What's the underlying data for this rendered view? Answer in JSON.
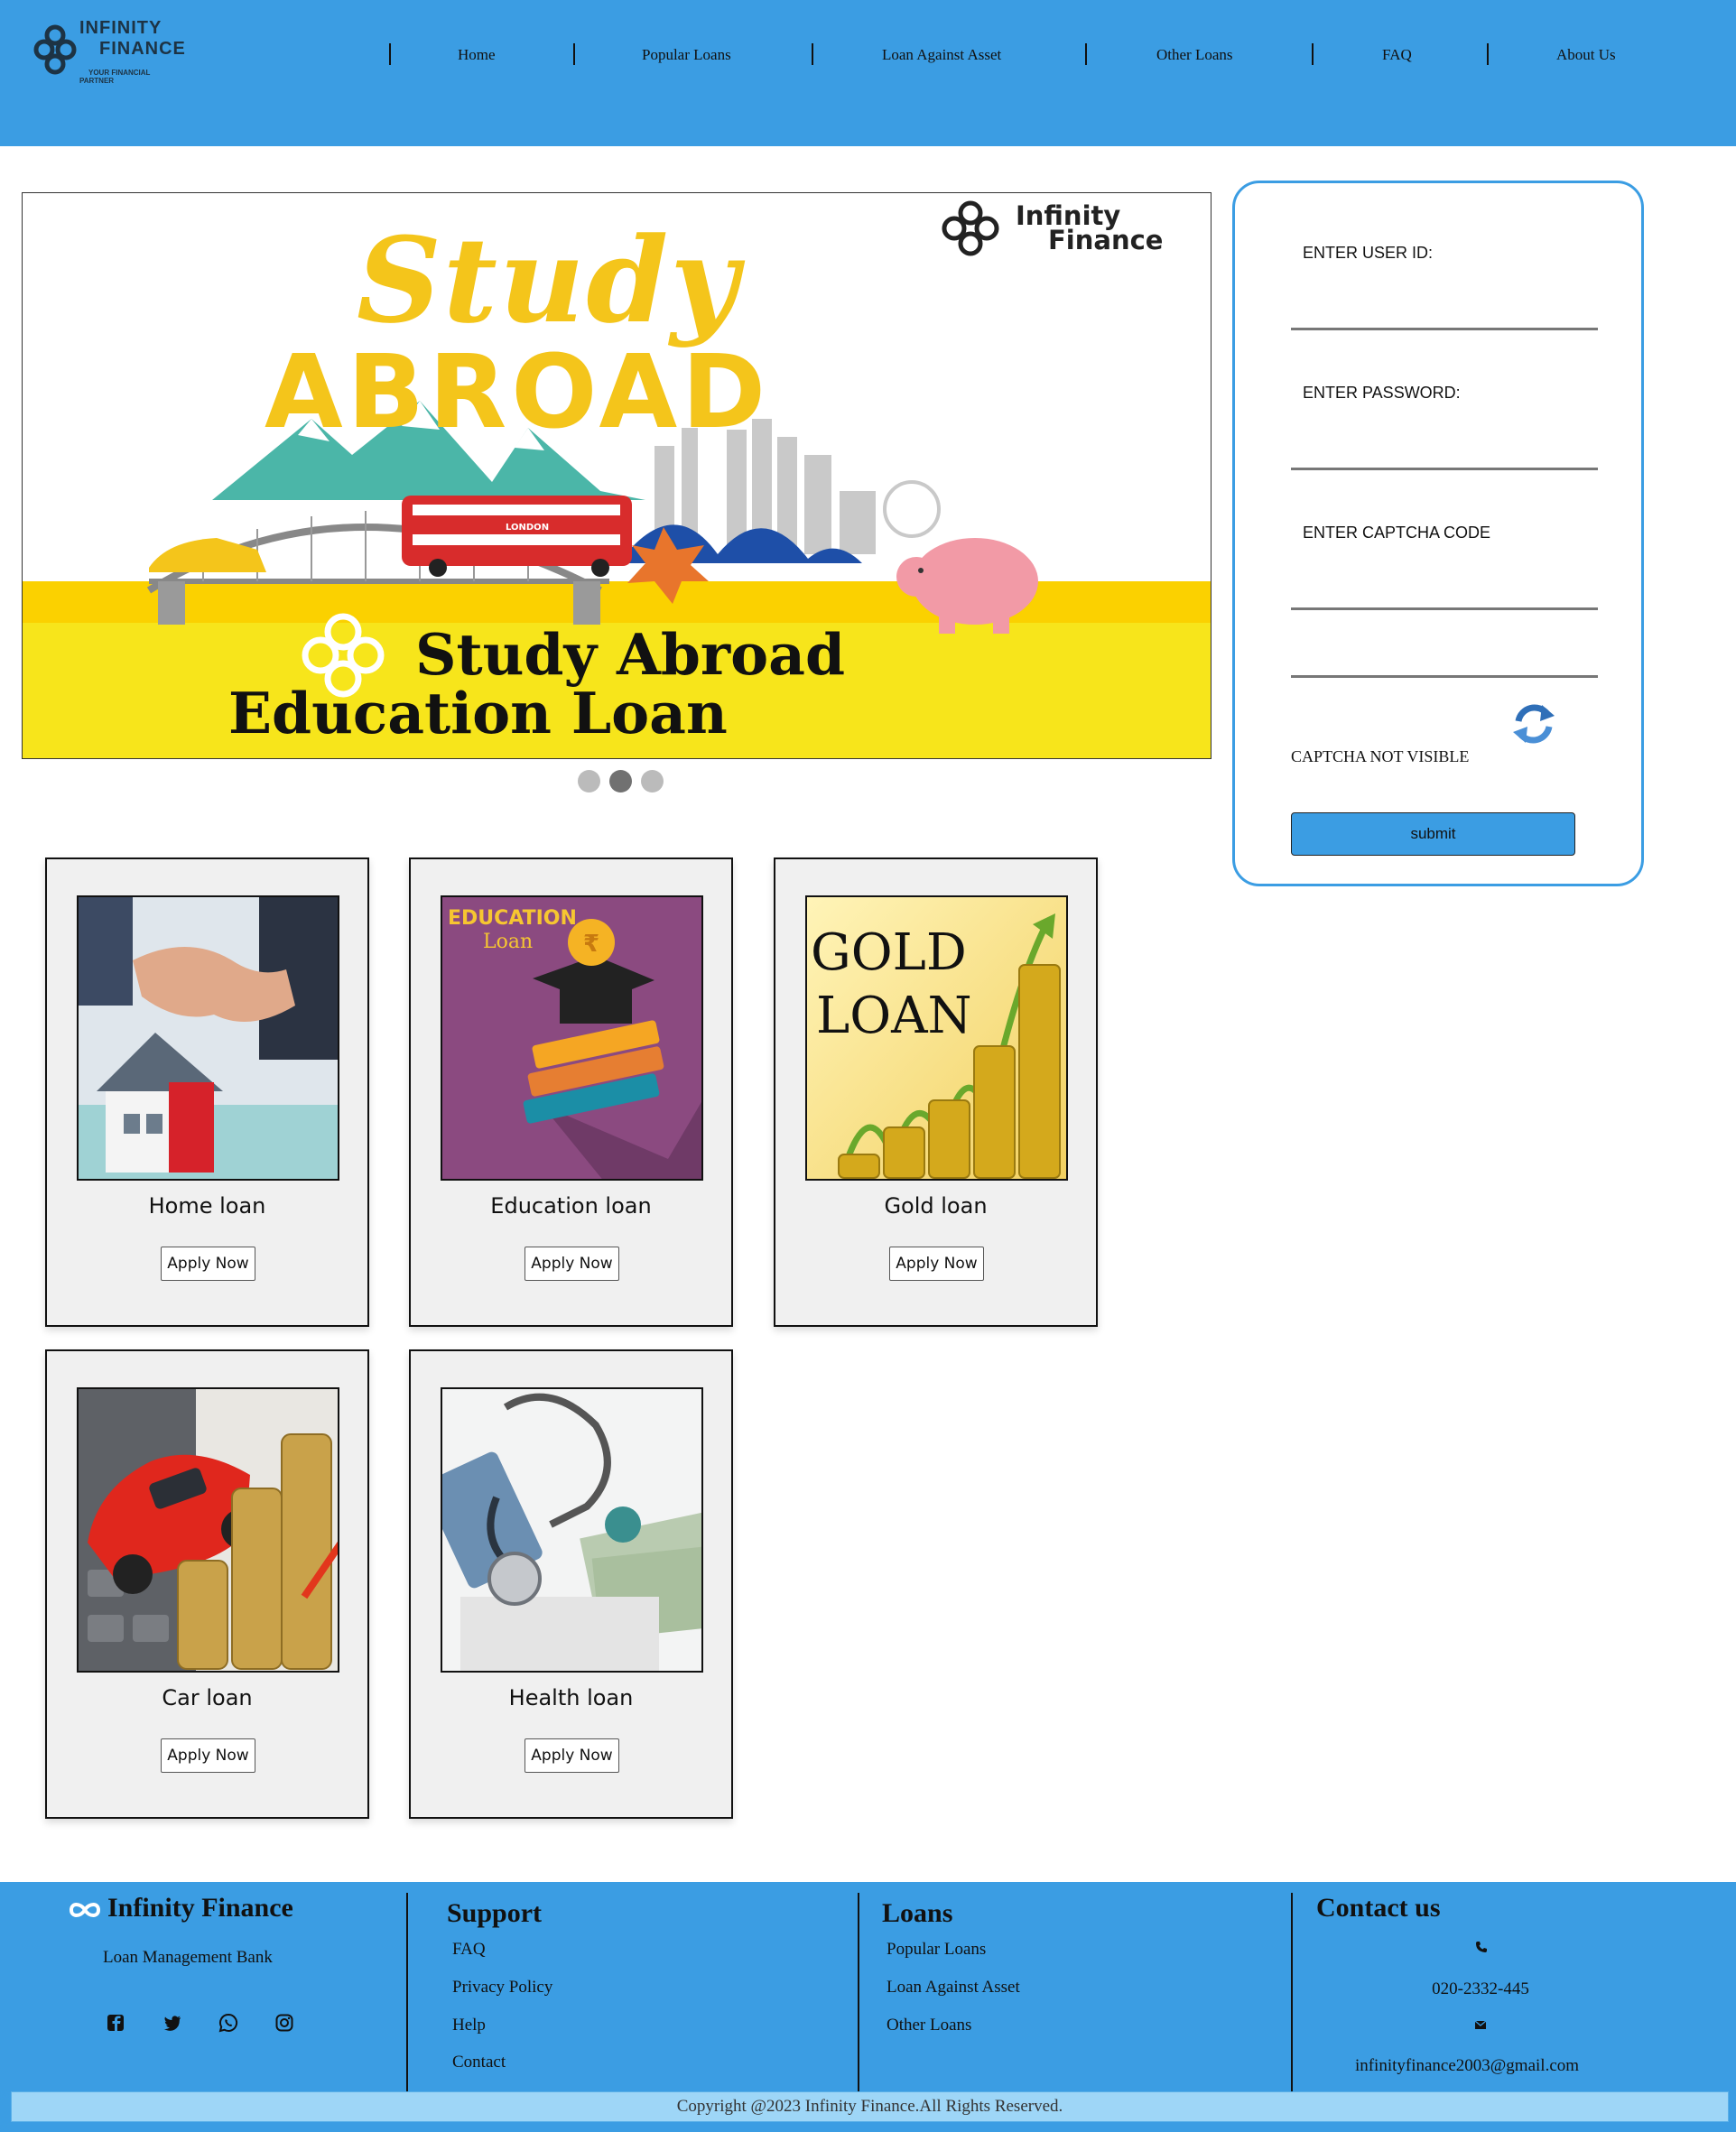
{
  "brand": {
    "name_line1": "INFINITY",
    "name_line2": "FINANCE",
    "tagline_line1": "YOUR FINANCIAL",
    "tagline_line2": "PARTNER"
  },
  "nav": [
    {
      "label": "Home"
    },
    {
      "label": "Popular Loans"
    },
    {
      "label": "Loan Against Asset"
    },
    {
      "label": "Other Loans"
    },
    {
      "label": "FAQ"
    },
    {
      "label": "About Us"
    }
  ],
  "slide": {
    "brand_line1": "Infinity",
    "brand_line2": "Finance",
    "headline_script": "Study",
    "headline_bold": "ABROAD",
    "bus_text": "LONDON",
    "title_line1": "Study Abroad",
    "title_line2": "Education Loan",
    "active_dot": 2,
    "dot_count": 3
  },
  "login": {
    "user_id_label": "ENTER USER ID:",
    "password_label": "ENTER PASSWORD:",
    "captcha_label": "ENTER CAPTCHA CODE",
    "captcha_not_visible": "CAPTCHA NOT VISIBLE",
    "submit_label": "submit"
  },
  "cards": [
    {
      "title": "Home loan",
      "button": "Apply Now",
      "image": "handshake-house"
    },
    {
      "title": "Education loan",
      "button": "Apply Now",
      "image": "education-books",
      "image_text_1": "EDUCATION",
      "image_text_2": "Loan",
      "image_text_3": "₹"
    },
    {
      "title": "Gold loan",
      "button": "Apply Now",
      "image": "gold-coins",
      "image_text_1": "GOLD",
      "image_text_2": "LOAN"
    },
    {
      "title": "Car loan",
      "button": "Apply Now",
      "image": "car-coins"
    },
    {
      "title": "Health loan",
      "button": "Apply Now",
      "image": "stethoscope-money"
    }
  ],
  "footer": {
    "brand": "Infinity Finance",
    "subtitle": "Loan Management Bank",
    "social_icons": [
      "facebook-icon",
      "twitter-icon",
      "whatsapp-icon",
      "instagram-icon"
    ],
    "support_heading": "Support",
    "support_links": [
      "FAQ",
      "Privacy Policy",
      "Help",
      "Contact"
    ],
    "loans_heading": "Loans",
    "loans_links": [
      "Popular Loans",
      "Loan Against Asset",
      "Other Loans"
    ],
    "contact_heading": "Contact us",
    "phone": "020-2332-445",
    "email": "infinityfinance2003@gmail.com",
    "copyright": "Copyright @2023 Infinity Finance.All Rights Reserved."
  },
  "colors": {
    "header_blue": "#3b9de3",
    "slide_yellow": "#f4c51b",
    "copyright_bg": "#9ed6f7"
  }
}
